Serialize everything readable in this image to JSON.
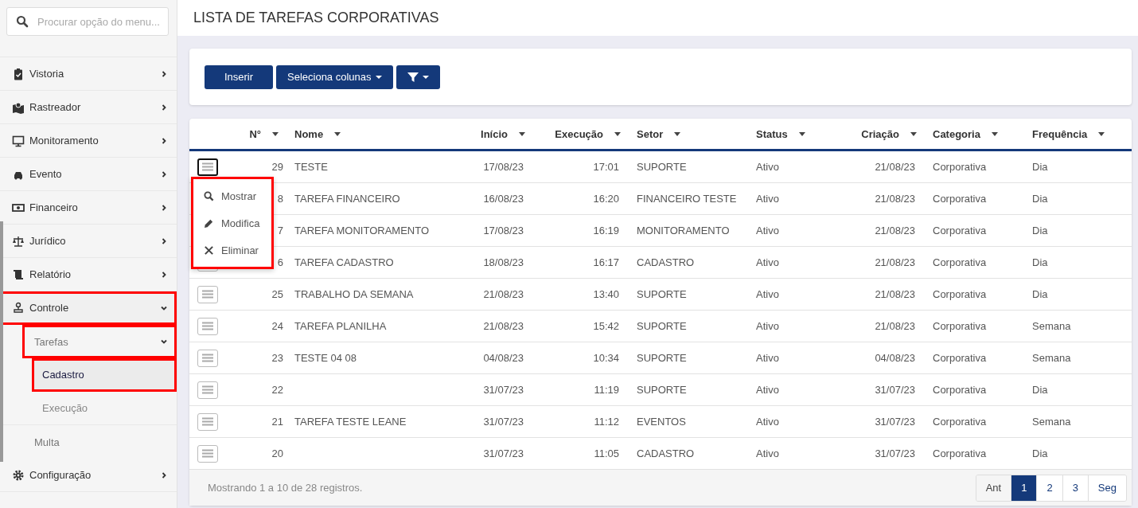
{
  "sidebar": {
    "search": {
      "placeholder": "Procurar opção do menu..."
    },
    "items": [
      {
        "label": "Vistoria",
        "expanded": false,
        "highlighted": false
      },
      {
        "label": "Rastreador",
        "expanded": false,
        "highlighted": false
      },
      {
        "label": "Monitoramento",
        "expanded": false,
        "highlighted": false
      },
      {
        "label": "Evento",
        "expanded": false,
        "highlighted": false
      },
      {
        "label": "Financeiro",
        "expanded": false,
        "highlighted": false
      },
      {
        "label": "Jurídico",
        "expanded": false,
        "highlighted": false
      },
      {
        "label": "Relatório",
        "expanded": false,
        "highlighted": false
      },
      {
        "label": "Controle",
        "expanded": true,
        "highlighted": true,
        "children": [
          {
            "label": "Tarefas",
            "expanded": true,
            "highlighted": true,
            "children": [
              {
                "label": "Cadastro",
                "selected": true,
                "highlighted": true
              },
              {
                "label": "Execução",
                "selected": false,
                "highlighted": false
              }
            ]
          },
          {
            "label": "Multa",
            "highlighted": false
          }
        ]
      },
      {
        "label": "Configuração",
        "expanded": false,
        "highlighted": false
      }
    ]
  },
  "page_title": "LISTA DE TAREFAS CORPORATIVAS",
  "toolbar": [
    {
      "label": "Inserir",
      "kind": "text"
    },
    {
      "label": "Seleciona colunas",
      "kind": "dropdown"
    },
    {
      "kind": "filter"
    }
  ],
  "table": {
    "columns": [
      {
        "label": "N°"
      },
      {
        "label": "Nome"
      },
      {
        "label": "Início"
      },
      {
        "label": "Execução"
      },
      {
        "label": "Setor"
      },
      {
        "label": "Status"
      },
      {
        "label": "Criação"
      },
      {
        "label": "Categoria"
      },
      {
        "label": "Frequência"
      }
    ],
    "rows": [
      {
        "cells": [
          "29",
          "TESTE",
          "17/08/23",
          "17:01",
          "SUPORTE",
          "Ativo",
          "21/08/23",
          "Corporativa",
          "Dia"
        ]
      },
      {
        "cells": [
          "8",
          "TAREFA FINANCEIRO",
          "16/08/23",
          "16:20",
          "FINANCEIRO TESTE",
          "Ativo",
          "21/08/23",
          "Corporativa",
          "Dia"
        ]
      },
      {
        "cells": [
          "7",
          "TAREFA MONITORAMENTO",
          "17/08/23",
          "16:19",
          "MONITORAMENTO",
          "Ativo",
          "21/08/23",
          "Corporativa",
          "Dia"
        ]
      },
      {
        "cells": [
          "6",
          "TAREFA CADASTRO",
          "18/08/23",
          "16:17",
          "CADASTRO",
          "Ativo",
          "21/08/23",
          "Corporativa",
          "Dia"
        ]
      },
      {
        "cells": [
          "25",
          "TRABALHO DA SEMANA",
          "21/08/23",
          "13:40",
          "SUPORTE",
          "Ativo",
          "21/08/23",
          "Corporativa",
          "Dia"
        ]
      },
      {
        "cells": [
          "24",
          "TAREFA PLANILHA",
          "21/08/23",
          "15:42",
          "SUPORTE",
          "Ativo",
          "21/08/23",
          "Corporativa",
          "Semana"
        ]
      },
      {
        "cells": [
          "23",
          "TESTE 04 08",
          "04/08/23",
          "10:34",
          "SUPORTE",
          "Ativo",
          "04/08/23",
          "Corporativa",
          "Semana"
        ]
      },
      {
        "cells": [
          "22",
          "",
          "31/07/23",
          "11:19",
          "SUPORTE",
          "Ativo",
          "31/07/23",
          "Corporativa",
          "Dia"
        ]
      },
      {
        "cells": [
          "21",
          "TAREFA TESTE LEANE",
          "31/07/23",
          "11:12",
          "EVENTOS",
          "Ativo",
          "31/07/23",
          "Corporativa",
          "Semana"
        ]
      },
      {
        "cells": [
          "20",
          "",
          "31/07/23",
          "11:05",
          "CADASTRO",
          "Ativo",
          "31/07/23",
          "Corporativa",
          "Dia"
        ]
      }
    ],
    "row_menu": {
      "open": true,
      "highlighted": true,
      "items": [
        {
          "label": "Mostrar"
        },
        {
          "label": "Modifica"
        },
        {
          "label": "Eliminar"
        }
      ]
    },
    "footer": "Mostrando 1 a 10 de 28 registros.",
    "pagination": [
      {
        "label": "Ant",
        "selected": false
      },
      {
        "label": "1",
        "selected": true
      },
      {
        "label": "2",
        "selected": false
      },
      {
        "label": "3",
        "selected": false
      },
      {
        "label": "Seg",
        "selected": false
      }
    ]
  }
}
